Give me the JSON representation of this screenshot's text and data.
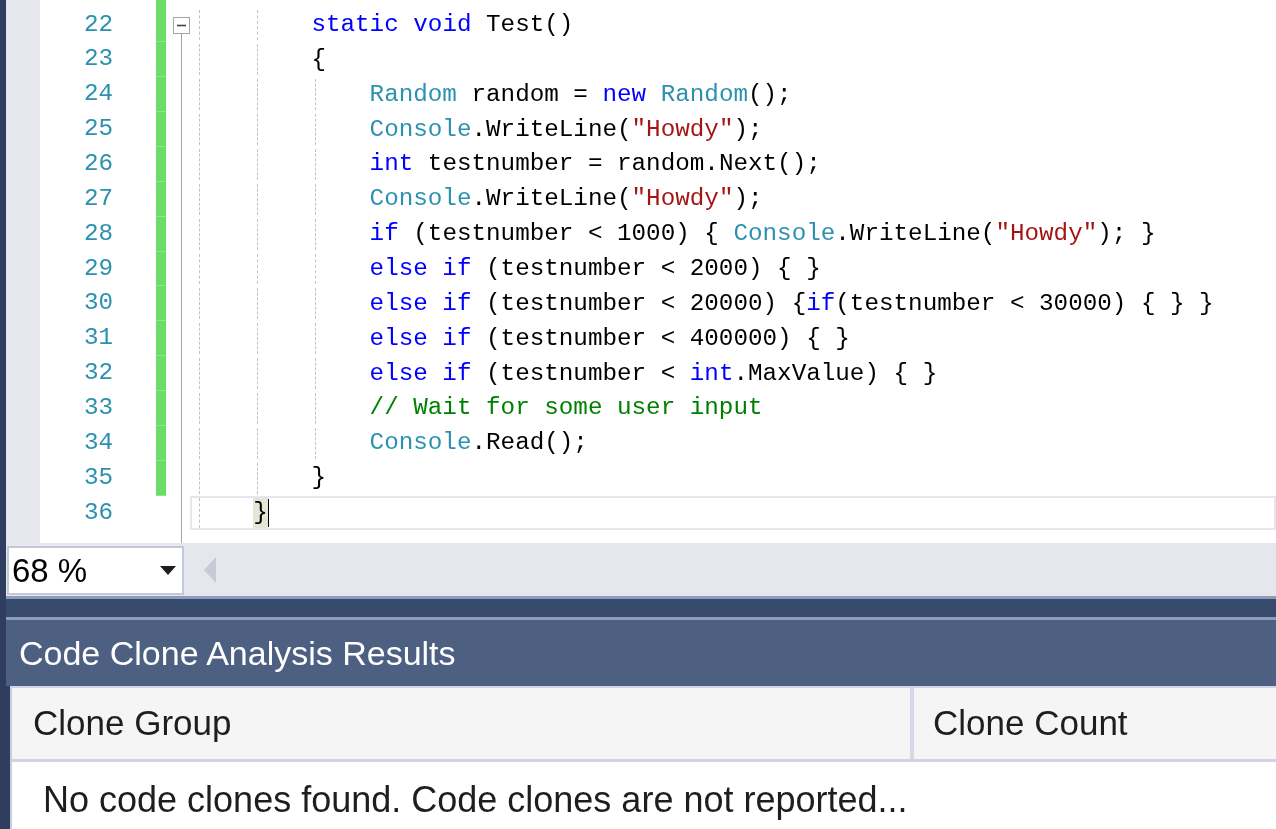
{
  "editor": {
    "lines": [
      {
        "number": "22",
        "changed": true,
        "collapsible": true,
        "current": false,
        "tokens": [
          {
            "kind": "keyword",
            "text": "        static void"
          },
          {
            "kind": "plain",
            "text": " Test()"
          }
        ]
      },
      {
        "number": "23",
        "changed": true,
        "collapsible": false,
        "current": false,
        "tokens": [
          {
            "kind": "plain",
            "text": "        {"
          }
        ]
      },
      {
        "number": "24",
        "changed": true,
        "collapsible": false,
        "current": false,
        "tokens": [
          {
            "kind": "type",
            "text": "            Random"
          },
          {
            "kind": "plain",
            "text": " random = "
          },
          {
            "kind": "keyword",
            "text": "new "
          },
          {
            "kind": "type",
            "text": "Random"
          },
          {
            "kind": "plain",
            "text": "();"
          }
        ]
      },
      {
        "number": "25",
        "changed": true,
        "collapsible": false,
        "current": false,
        "tokens": [
          {
            "kind": "type",
            "text": "            Console"
          },
          {
            "kind": "plain",
            "text": ".WriteLine("
          },
          {
            "kind": "string",
            "text": "\"Howdy\""
          },
          {
            "kind": "plain",
            "text": ");"
          }
        ]
      },
      {
        "number": "26",
        "changed": true,
        "collapsible": false,
        "current": false,
        "tokens": [
          {
            "kind": "keyword",
            "text": "            int"
          },
          {
            "kind": "plain",
            "text": " testnumber = random.Next();"
          }
        ]
      },
      {
        "number": "27",
        "changed": true,
        "collapsible": false,
        "current": false,
        "tokens": [
          {
            "kind": "type",
            "text": "            Console"
          },
          {
            "kind": "plain",
            "text": ".WriteLine("
          },
          {
            "kind": "string",
            "text": "\"Howdy\""
          },
          {
            "kind": "plain",
            "text": ");"
          }
        ]
      },
      {
        "number": "28",
        "changed": true,
        "collapsible": false,
        "current": false,
        "tokens": [
          {
            "kind": "keyword",
            "text": "            if"
          },
          {
            "kind": "plain",
            "text": " (testnumber < 1000) { "
          },
          {
            "kind": "type",
            "text": "Console"
          },
          {
            "kind": "plain",
            "text": ".WriteLine("
          },
          {
            "kind": "string",
            "text": "\"Howdy\""
          },
          {
            "kind": "plain",
            "text": "); }"
          }
        ]
      },
      {
        "number": "29",
        "changed": true,
        "collapsible": false,
        "current": false,
        "tokens": [
          {
            "kind": "keyword",
            "text": "            else if"
          },
          {
            "kind": "plain",
            "text": " (testnumber < 2000) { }"
          }
        ]
      },
      {
        "number": "30",
        "changed": true,
        "collapsible": false,
        "current": false,
        "tokens": [
          {
            "kind": "keyword",
            "text": "            else if"
          },
          {
            "kind": "plain",
            "text": " (testnumber < 20000) {"
          },
          {
            "kind": "keyword",
            "text": "if"
          },
          {
            "kind": "plain",
            "text": "(testnumber < 30000) { } }"
          }
        ]
      },
      {
        "number": "31",
        "changed": true,
        "collapsible": false,
        "current": false,
        "tokens": [
          {
            "kind": "keyword",
            "text": "            else if"
          },
          {
            "kind": "plain",
            "text": " (testnumber < 400000) { }"
          }
        ]
      },
      {
        "number": "32",
        "changed": true,
        "collapsible": false,
        "current": false,
        "tokens": [
          {
            "kind": "keyword",
            "text": "            else if"
          },
          {
            "kind": "plain",
            "text": " (testnumber < "
          },
          {
            "kind": "keyword",
            "text": "int"
          },
          {
            "kind": "plain",
            "text": ".MaxValue) { }"
          }
        ]
      },
      {
        "number": "33",
        "changed": true,
        "collapsible": false,
        "current": false,
        "tokens": [
          {
            "kind": "comment",
            "text": "            // Wait for some user input"
          }
        ]
      },
      {
        "number": "34",
        "changed": true,
        "collapsible": false,
        "current": false,
        "tokens": [
          {
            "kind": "type",
            "text": "            Console"
          },
          {
            "kind": "plain",
            "text": ".Read();"
          }
        ]
      },
      {
        "number": "35",
        "changed": true,
        "collapsible": false,
        "current": false,
        "tokens": [
          {
            "kind": "plain",
            "text": "        }"
          }
        ]
      },
      {
        "number": "36",
        "changed": false,
        "collapsible": false,
        "current": true,
        "tokens": [
          {
            "kind": "match",
            "text": "    }"
          }
        ]
      }
    ]
  },
  "zoom": {
    "value": "68 %"
  },
  "tool_window": {
    "title": "Code Clone Analysis Results",
    "table": {
      "columns": [
        "Clone Group",
        "Clone Count"
      ],
      "empty_message": "No code clones found. Code clones are not reported..."
    }
  }
}
